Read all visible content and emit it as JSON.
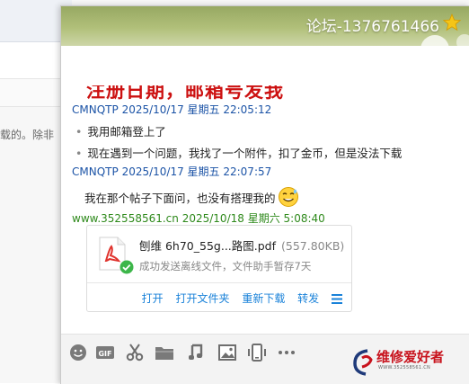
{
  "background_page": {
    "snippet": "载的。除非"
  },
  "window": {
    "title": "论坛-1376761466",
    "star_icon": "star-icon"
  },
  "messages": {
    "headline": "注册日期，邮箱号发我",
    "items": [
      {
        "sender": "CMNQTP",
        "time": "2025/10/17 星期五 22:05:12",
        "lines": [
          "我用邮箱登上了",
          "现在遇到一个问题，我找了一个附件，扣了金币，但是没法下载"
        ]
      },
      {
        "sender": "CMNQTP",
        "time": "2025/10/17 星期五 22:07:57",
        "lines": [
          "我在那个帖子下面问，也没有搭理我的"
        ]
      },
      {
        "sender": "www.352558561.cn",
        "time": "2025/10/18 星期六 5:08:40",
        "lines": []
      }
    ]
  },
  "file_card": {
    "name": "刨维 6h70_55g...路图.pdf",
    "size": "(557.80KB)",
    "status": "成功发送离线文件，文件助手暂存7天",
    "actions": [
      "打开",
      "打开文件夹",
      "重新下载",
      "转发"
    ]
  },
  "toolbar": {
    "icons": [
      "emoji-icon",
      "gif-icon",
      "scissors-icon",
      "folder-icon",
      "music-icon",
      "image-icon",
      "screen-share-icon",
      "more-icon"
    ]
  },
  "brand": {
    "name": "维修爱好者",
    "url": "WWW.352558561.CN"
  },
  "colors": {
    "title_bar": "#a3b36c",
    "link_blue": "#1a82d9",
    "sender_blue": "#1b53a6",
    "sender_green": "#2f8a1c",
    "headline_red": "#cc1111"
  }
}
